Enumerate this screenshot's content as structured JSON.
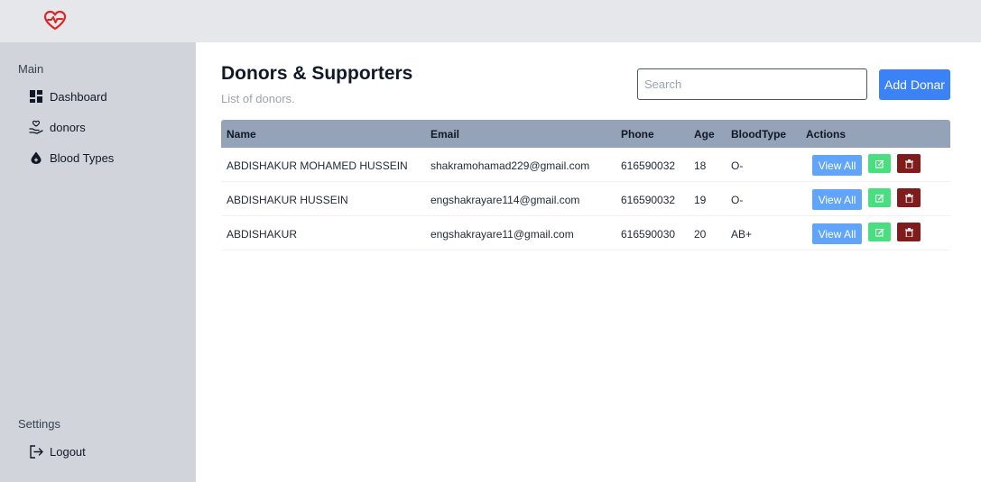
{
  "app": {
    "logo_icon": "heart-pulse-icon",
    "brand_color": "#dc2626"
  },
  "sidebar": {
    "main_heading": "Main",
    "items": [
      {
        "label": "Dashboard",
        "icon": "dashboard-icon"
      },
      {
        "label": "donors",
        "icon": "hand-heart-icon"
      },
      {
        "label": "Blood Types",
        "icon": "blood-drop-icon"
      }
    ],
    "settings_heading": "Settings",
    "logout_label": "Logout"
  },
  "main": {
    "title": "Donors & Supporters",
    "subtitle": "List of donors.",
    "search_placeholder": "Search",
    "add_button_label": "Add Donar"
  },
  "table": {
    "columns": [
      "Name",
      "Email",
      "Phone",
      "Age",
      "BloodType",
      "Actions"
    ],
    "rows": [
      {
        "name": "ABDISHAKUR MOHAMED HUSSEIN",
        "email": "shakramohamad229@gmail.com",
        "phone": "616590032",
        "age": "18",
        "blood": "O-",
        "view_label": "View All"
      },
      {
        "name": "ABDISHAKUR HUSSEIN",
        "email": "engshakrayare114@gmail.com",
        "phone": "616590032",
        "age": "19",
        "blood": "O-",
        "view_label": "View All"
      },
      {
        "name": "ABDISHAKUR",
        "email": "engshakrayare11@gmail.com",
        "phone": "616590030",
        "age": "20",
        "blood": "AB+",
        "view_label": "View All"
      }
    ],
    "header_color": "#94a3b8"
  }
}
